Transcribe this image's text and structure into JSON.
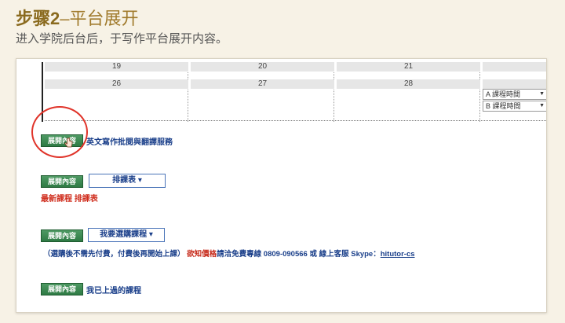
{
  "heading": {
    "step": "步骤2",
    "sep": "–",
    "title": "平台展开"
  },
  "subtitle": "进入学院后台后，于写作平台展开内容。",
  "calendar": {
    "row1": [
      "19",
      "20",
      "21",
      ""
    ],
    "row2": [
      "26",
      "27",
      "28",
      ""
    ],
    "schedule": [
      {
        "label": "A 課程時間"
      },
      {
        "label": "B 課程時間"
      }
    ]
  },
  "sections": {
    "expand_label": "展開內容",
    "writing_link": "英文寫作批閱與翻譯服務",
    "schedule_dropdown": "排課表",
    "latest_course": "最新課程 排課表",
    "buy_dropdown": "我要選購課程",
    "note_blue1": "（選購後不需先付費，付費後再開始上課）",
    "note_red": "欲知價格",
    "note_blue2": "請洽免費專線 0809-090566 或 線上客服 Skype：",
    "note_skype": "hitutor-cs",
    "taken_courses": "我已上過的課程"
  },
  "colors": {
    "accent": "#8a6a1e",
    "button_green": "#2e7a44",
    "link_blue": "#1a3f8a",
    "highlight_red": "#e0342a"
  }
}
